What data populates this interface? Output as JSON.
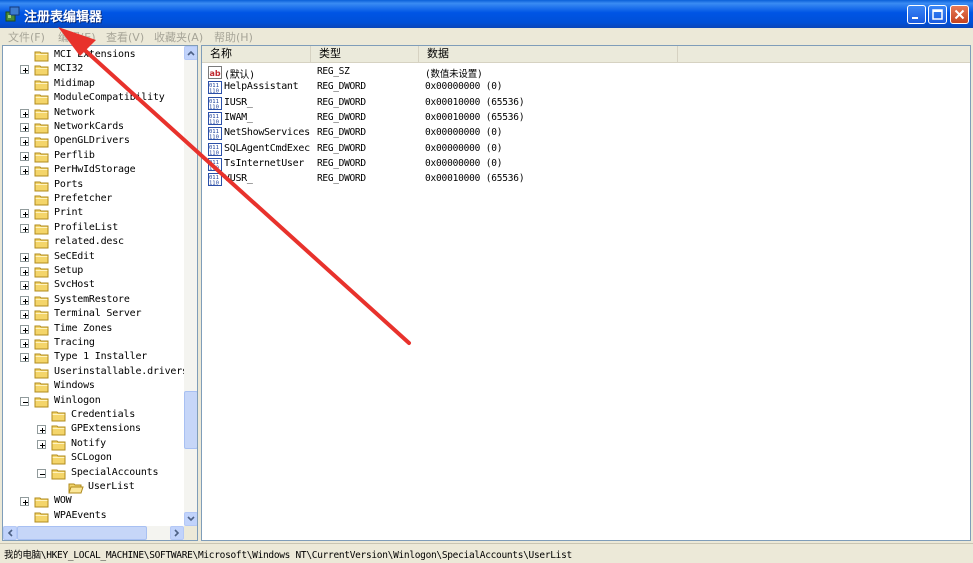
{
  "window": {
    "title": "注册表编辑器",
    "controls": [
      "minimize",
      "maximize",
      "close"
    ],
    "app_icon": "regedit-icon"
  },
  "menu": [
    {
      "label": "文件(F)"
    },
    {
      "label": "编辑(E)"
    },
    {
      "label": "查看(V)"
    },
    {
      "label": "收藏夹(A)"
    },
    {
      "label": "帮助(H)"
    }
  ],
  "tree": {
    "items": [
      {
        "label": "MCI Extensions",
        "level": 0,
        "expander": "none"
      },
      {
        "label": "MCI32",
        "level": 0,
        "expander": "plus"
      },
      {
        "label": "Midimap",
        "level": 0,
        "expander": "none"
      },
      {
        "label": "ModuleCompatibility",
        "level": 0,
        "expander": "none"
      },
      {
        "label": "Network",
        "level": 0,
        "expander": "plus"
      },
      {
        "label": "NetworkCards",
        "level": 0,
        "expander": "plus"
      },
      {
        "label": "OpenGLDrivers",
        "level": 0,
        "expander": "plus"
      },
      {
        "label": "Perflib",
        "level": 0,
        "expander": "plus"
      },
      {
        "label": "PerHwIdStorage",
        "level": 0,
        "expander": "plus"
      },
      {
        "label": "Ports",
        "level": 0,
        "expander": "none"
      },
      {
        "label": "Prefetcher",
        "level": 0,
        "expander": "none"
      },
      {
        "label": "Print",
        "level": 0,
        "expander": "plus"
      },
      {
        "label": "ProfileList",
        "level": 0,
        "expander": "plus"
      },
      {
        "label": "related.desc",
        "level": 0,
        "expander": "none"
      },
      {
        "label": "SeCEdit",
        "level": 0,
        "expander": "plus"
      },
      {
        "label": "Setup",
        "level": 0,
        "expander": "plus"
      },
      {
        "label": "SvcHost",
        "level": 0,
        "expander": "plus"
      },
      {
        "label": "SystemRestore",
        "level": 0,
        "expander": "plus"
      },
      {
        "label": "Terminal Server",
        "level": 0,
        "expander": "plus"
      },
      {
        "label": "Time Zones",
        "level": 0,
        "expander": "plus"
      },
      {
        "label": "Tracing",
        "level": 0,
        "expander": "plus"
      },
      {
        "label": "Type 1 Installer",
        "level": 0,
        "expander": "plus"
      },
      {
        "label": "Userinstallable.drivers",
        "level": 0,
        "expander": "none"
      },
      {
        "label": "Windows",
        "level": 0,
        "expander": "none"
      },
      {
        "label": "Winlogon",
        "level": 0,
        "expander": "minus"
      },
      {
        "label": "Credentials",
        "level": 1,
        "expander": "none"
      },
      {
        "label": "GPExtensions",
        "level": 1,
        "expander": "plus"
      },
      {
        "label": "Notify",
        "level": 1,
        "expander": "plus"
      },
      {
        "label": "SCLogon",
        "level": 1,
        "expander": "none"
      },
      {
        "label": "SpecialAccounts",
        "level": 1,
        "expander": "minus"
      },
      {
        "label": "UserList",
        "level": 2,
        "expander": "none",
        "selected": true
      },
      {
        "label": "WOW",
        "level": 0,
        "expander": "plus"
      },
      {
        "label": "WPAEvents",
        "level": 0,
        "expander": "none"
      }
    ]
  },
  "list": {
    "columns": [
      "名称",
      "类型",
      "数据"
    ],
    "rows": [
      {
        "icon": "string-value-icon",
        "name": "(默认)",
        "type": "REG_SZ",
        "data": "(数值未设置)"
      },
      {
        "icon": "binary-value-icon",
        "name": "HelpAssistant",
        "type": "REG_DWORD",
        "data": "0x00000000 (0)"
      },
      {
        "icon": "binary-value-icon",
        "name": "IUSR_",
        "type": "REG_DWORD",
        "data": "0x00010000 (65536)"
      },
      {
        "icon": "binary-value-icon",
        "name": "IWAM_",
        "type": "REG_DWORD",
        "data": "0x00010000 (65536)"
      },
      {
        "icon": "binary-value-icon",
        "name": "NetShowServices",
        "type": "REG_DWORD",
        "data": "0x00000000 (0)"
      },
      {
        "icon": "binary-value-icon",
        "name": "SQLAgentCmdExec",
        "type": "REG_DWORD",
        "data": "0x00000000 (0)"
      },
      {
        "icon": "binary-value-icon",
        "name": "TsInternetUser",
        "type": "REG_DWORD",
        "data": "0x00000000 (0)"
      },
      {
        "icon": "binary-value-icon",
        "name": "VUSR_",
        "type": "REG_DWORD",
        "data": "0x00010000 (65536)"
      }
    ]
  },
  "status": {
    "path": "我的电脑\\HKEY_LOCAL_MACHINE\\SOFTWARE\\Microsoft\\Windows NT\\CurrentVersion\\Winlogon\\SpecialAccounts\\UserList"
  },
  "annotation": {
    "type": "red-arrow",
    "color": "#e8322c"
  }
}
